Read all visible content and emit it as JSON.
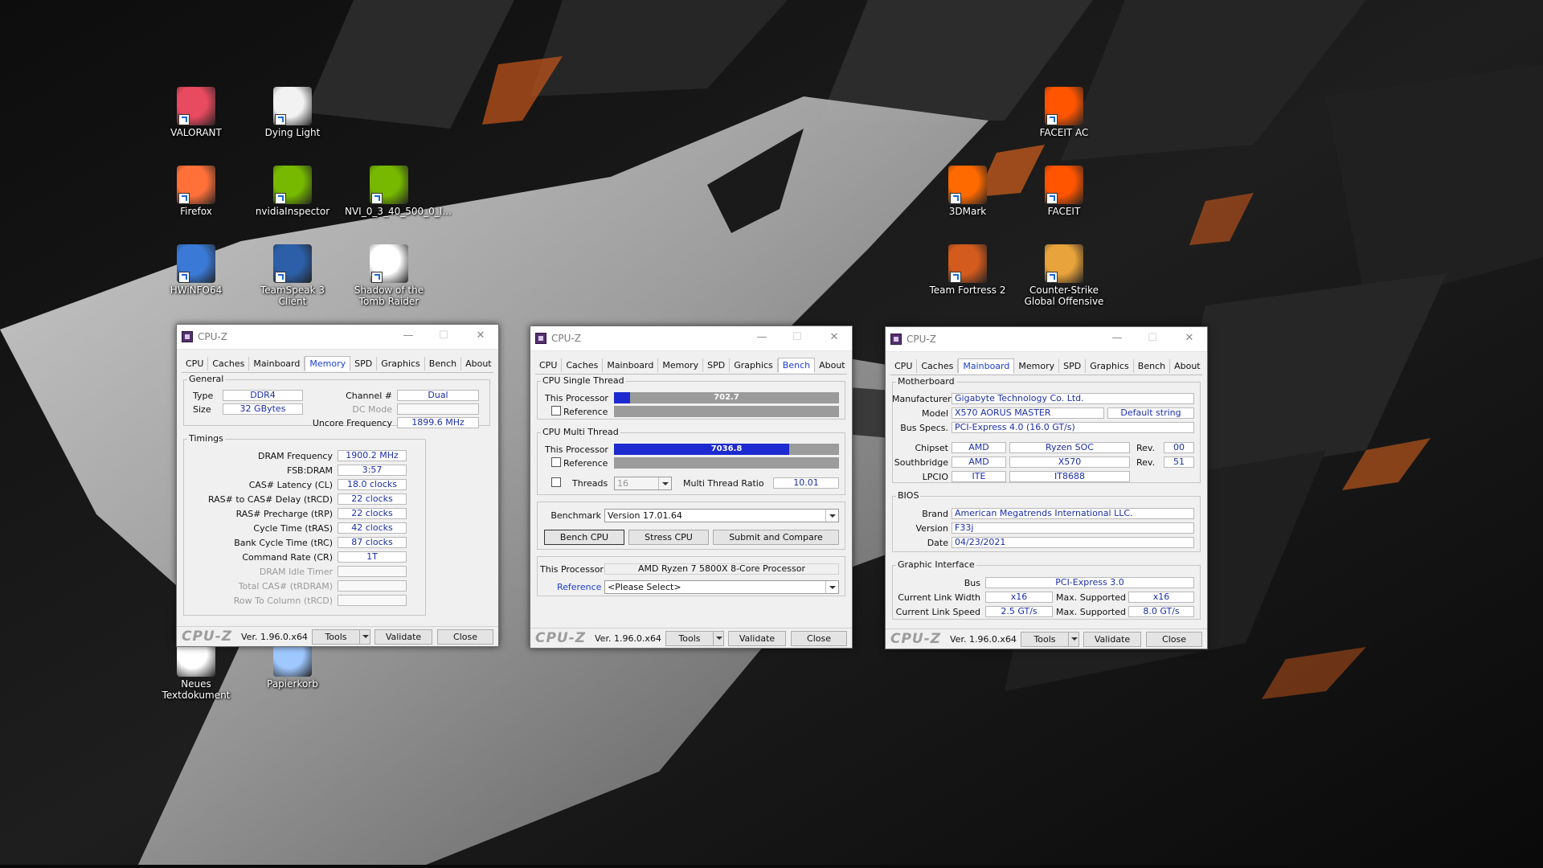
{
  "desktop": {
    "icons": [
      {
        "label": "VALORANT",
        "color": "#e84a5f"
      },
      {
        "label": "Dying Light",
        "color": "#f2f2f2"
      },
      {
        "label": "FACEIT AC",
        "color": "#ff5500"
      },
      {
        "label": "Firefox",
        "color": "#ff7139"
      },
      {
        "label": "nvidiaInspector",
        "color": "#76b900"
      },
      {
        "label": "NVI_0_3_40_500_0_I...",
        "color": "#76b900"
      },
      {
        "label": "3DMark",
        "color": "#ff6a00"
      },
      {
        "label": "FACEIT",
        "color": "#ff5500"
      },
      {
        "label": "HWiNFO64",
        "color": "#3a7ad6"
      },
      {
        "label": "TeamSpeak 3 Client",
        "color": "#2c5fa8"
      },
      {
        "label": "Shadow of the Tomb Raider",
        "color": "#ffffff"
      },
      {
        "label": "Team Fortress 2",
        "color": "#d35b1e"
      },
      {
        "label": "Counter-Strike Global Offensive",
        "color": "#e8a33c"
      },
      {
        "label": "Neues Textdokument",
        "color": "#ffffff"
      },
      {
        "label": "Papierkorb",
        "color": "#9fc8ff"
      }
    ]
  },
  "common": {
    "app_title": "CPU-Z",
    "logo": "CPU-Z",
    "version": "Ver. 1.96.0.x64",
    "tools_label": "Tools",
    "validate_label": "Validate",
    "close_label": "Close",
    "tabs": [
      "CPU",
      "Caches",
      "Mainboard",
      "Memory",
      "SPD",
      "Graphics",
      "Bench",
      "About"
    ],
    "minimize": "—",
    "maximize": "☐",
    "close_x": "✕"
  },
  "memory": {
    "general_title": "General",
    "type_label": "Type",
    "type_value": "DDR4",
    "size_label": "Size",
    "size_value": "32 GBytes",
    "channel_label": "Channel #",
    "channel_value": "Dual",
    "dcmode_label": "DC Mode",
    "dcmode_value": "",
    "uncore_label": "Uncore Frequency",
    "uncore_value": "1899.6 MHz",
    "timings_title": "Timings",
    "timings": [
      {
        "label": "DRAM Frequency",
        "value": "1900.2 MHz",
        "disabled": false
      },
      {
        "label": "FSB:DRAM",
        "value": "3:57",
        "disabled": false
      },
      {
        "label": "CAS# Latency (CL)",
        "value": "18.0 clocks",
        "disabled": false
      },
      {
        "label": "RAS# to CAS# Delay (tRCD)",
        "value": "22 clocks",
        "disabled": false
      },
      {
        "label": "RAS# Precharge (tRP)",
        "value": "22 clocks",
        "disabled": false
      },
      {
        "label": "Cycle Time (tRAS)",
        "value": "42 clocks",
        "disabled": false
      },
      {
        "label": "Bank Cycle Time (tRC)",
        "value": "87 clocks",
        "disabled": false
      },
      {
        "label": "Command Rate (CR)",
        "value": "1T",
        "disabled": false
      },
      {
        "label": "DRAM Idle Timer",
        "value": "",
        "disabled": true
      },
      {
        "label": "Total CAS# (tRDRAM)",
        "value": "",
        "disabled": true
      },
      {
        "label": "Row To Column (tRCD)",
        "value": "",
        "disabled": true
      }
    ]
  },
  "bench": {
    "single_title": "CPU Single Thread",
    "multi_title": "CPU Multi Thread",
    "this_processor_label": "This Processor",
    "reference_label": "Reference",
    "single_score": "702.7",
    "single_fraction": 0.07,
    "multi_score": "7036.8",
    "multi_fraction": 0.78,
    "threads_label": "Threads",
    "threads_value": "16",
    "ratio_label": "Multi Thread Ratio",
    "ratio_value": "10.01",
    "benchmark_label": "Benchmark",
    "benchmark_value": "Version 17.01.64",
    "bench_cpu_label": "Bench CPU",
    "stress_cpu_label": "Stress CPU",
    "submit_label": "Submit and Compare",
    "processor_label": "This Processor",
    "processor_value": "AMD Ryzen 7 5800X 8-Core Processor",
    "reference_link": "Reference",
    "reference_select": "<Please Select>"
  },
  "mainboard": {
    "mb_title": "Motherboard",
    "manufacturer_label": "Manufacturer",
    "manufacturer_value": "Gigabyte Technology Co. Ltd.",
    "model_label": "Model",
    "model_value": "X570 AORUS MASTER",
    "model_extra": "Default string",
    "busspecs_label": "Bus Specs.",
    "busspecs_value": "PCI-Express 4.0 (16.0 GT/s)",
    "chipset_label": "Chipset",
    "chipset_vendor": "AMD",
    "chipset_model": "Ryzen SOC",
    "chipset_rev_label": "Rev.",
    "chipset_rev": "00",
    "southbridge_label": "Southbridge",
    "southbridge_vendor": "AMD",
    "southbridge_model": "X570",
    "southbridge_rev_label": "Rev.",
    "southbridge_rev": "51",
    "lpcio_label": "LPCIO",
    "lpcio_vendor": "ITE",
    "lpcio_model": "IT8688",
    "bios_title": "BIOS",
    "brand_label": "Brand",
    "brand_value": "American Megatrends International LLC.",
    "version_label": "Version",
    "version_value": "F33j",
    "date_label": "Date",
    "date_value": "04/23/2021",
    "gi_title": "Graphic Interface",
    "bus_label": "Bus",
    "bus_value": "PCI-Express 3.0",
    "clw_label": "Current Link Width",
    "clw_value": "x16",
    "msw_label": "Max. Supported",
    "msw_value": "x16",
    "cls_label": "Current Link Speed",
    "cls_value": "2.5 GT/s",
    "mss_label": "Max. Supported",
    "mss_value": "8.0 GT/s"
  }
}
